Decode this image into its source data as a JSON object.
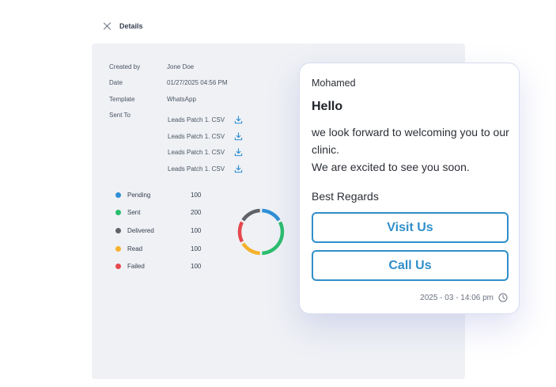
{
  "header": {
    "title": "Details"
  },
  "details": {
    "created_by_label": "Created by",
    "created_by": "Jone Doe",
    "date_label": "Date",
    "date": "01/27/2025 04:56 PM",
    "template_label": "Template",
    "template": "WhatsApp",
    "sent_to_label": "Sent To",
    "files": [
      "Leads Patch 1. CSV",
      "Leads Patch 1. CSV",
      "Leads Patch 1. CSV",
      "Leads Patch 1. CSV"
    ]
  },
  "stats": [
    {
      "label": "Pending",
      "value": "100",
      "color": "#2f8fd6"
    },
    {
      "label": "Sent",
      "value": "200",
      "color": "#2bbd6e"
    },
    {
      "label": "Delivered",
      "value": "100",
      "color": "#5f6368"
    },
    {
      "label": "Read",
      "value": "100",
      "color": "#f5b12b"
    },
    {
      "label": "Failed",
      "value": "100",
      "color": "#e5484d"
    }
  ],
  "message": {
    "sender": "Mohamed",
    "greeting": "Hello",
    "body_line1": "we look forward to welcoming you to our clinic.",
    "body_line2": "We are excited to see you soon.",
    "signoff": "Best Regards",
    "button_visit": "Visit Us",
    "button_call": "Call Us",
    "timestamp": "2025 - 03 - 14:06 pm"
  },
  "accent_color": "#2f8fc9"
}
